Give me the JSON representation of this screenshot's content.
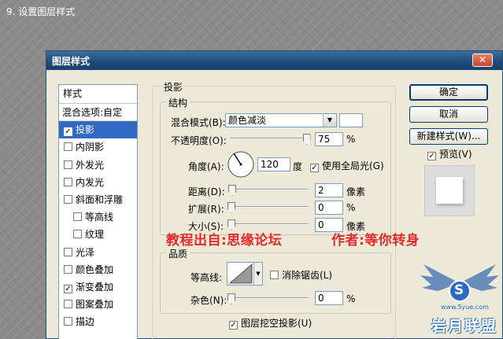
{
  "step_title": "9. 设置图层样式",
  "dialog": {
    "title": "图层样式",
    "close_glyph": "✕"
  },
  "style_list": {
    "header": "样式",
    "blend_options": "混合选项:自定",
    "items": [
      {
        "label": "投影",
        "checked": true,
        "selected": true,
        "sub": false
      },
      {
        "label": "内阴影",
        "checked": false,
        "selected": false,
        "sub": false
      },
      {
        "label": "外发光",
        "checked": false,
        "selected": false,
        "sub": false
      },
      {
        "label": "内发光",
        "checked": false,
        "selected": false,
        "sub": false
      },
      {
        "label": "斜面和浮雕",
        "checked": false,
        "selected": false,
        "sub": false
      },
      {
        "label": "等高线",
        "checked": false,
        "selected": false,
        "sub": true
      },
      {
        "label": "纹理",
        "checked": false,
        "selected": false,
        "sub": true
      },
      {
        "label": "光泽",
        "checked": false,
        "selected": false,
        "sub": false
      },
      {
        "label": "颜色叠加",
        "checked": false,
        "selected": false,
        "sub": false
      },
      {
        "label": "渐变叠加",
        "checked": true,
        "selected": false,
        "sub": false
      },
      {
        "label": "图案叠加",
        "checked": false,
        "selected": false,
        "sub": false
      },
      {
        "label": "描边",
        "checked": false,
        "selected": false,
        "sub": false
      }
    ]
  },
  "buttons": {
    "ok": "确定",
    "cancel": "取消",
    "new_style": "新建样式(W)...",
    "preview": "预览(V)"
  },
  "shadow": {
    "section": "投影",
    "structure": "结构",
    "blend_mode_label": "混合模式(B):",
    "blend_mode_value": "颜色减淡",
    "opacity_label": "不透明度(O):",
    "opacity_value": "75",
    "opacity_unit": "%",
    "opacity_level": 75,
    "angle_label": "角度(A):",
    "angle_value": "120",
    "angle_unit": "度",
    "global_light": "使用全局光(G)",
    "distance_label": "距离(D):",
    "distance_value": "2",
    "distance_unit": "像素",
    "spread_label": "扩展(R):",
    "spread_value": "0",
    "spread_unit": "%",
    "size_label": "大小(S):",
    "size_value": "0",
    "size_unit": "像素",
    "quality": "品质",
    "contour_label": "等高线:",
    "anti_alias": "消除锯齿(L)",
    "noise_label": "杂色(N):",
    "noise_value": "0",
    "noise_unit": "%",
    "knockout": "图层挖空投影(U)"
  },
  "overlay": {
    "source_text": "教程出自:思缘论坛",
    "author_text": "作者:等你转身"
  },
  "logo": {
    "letter": "S",
    "site": "www.5yue.com",
    "name": "岩月联盟"
  },
  "colors": {
    "selection": "#316ac5",
    "watermark": "#e32b2b",
    "logo_blue": "#2b6cc0"
  }
}
